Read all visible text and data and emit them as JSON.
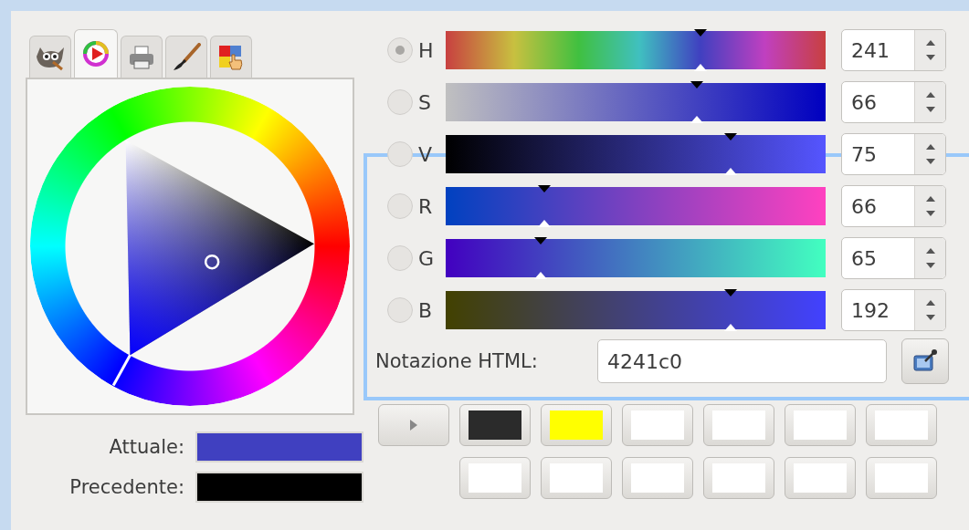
{
  "tabs": [
    {
      "kind": "mascot",
      "selected": false
    },
    {
      "kind": "wheel",
      "selected": true
    },
    {
      "kind": "printer",
      "selected": false
    },
    {
      "kind": "brush",
      "selected": false
    },
    {
      "kind": "palette",
      "selected": false
    }
  ],
  "current": {
    "label": "Attuale:",
    "color": "#4040c0"
  },
  "previous": {
    "label": "Precedente:",
    "color": "#000000"
  },
  "sliders": [
    {
      "label": "H",
      "selected": true,
      "level": 0.67,
      "value": "241"
    },
    {
      "label": "S",
      "selected": false,
      "level": 0.66,
      "value": "66"
    },
    {
      "label": "V",
      "selected": false,
      "level": 0.75,
      "value": "75"
    },
    {
      "label": "R",
      "selected": false,
      "level": 0.26,
      "value": "66"
    },
    {
      "label": "G",
      "selected": false,
      "level": 0.25,
      "value": "65"
    },
    {
      "label": "B",
      "selected": false,
      "level": 0.75,
      "value": "192"
    }
  ],
  "html_notation": {
    "label": "Notazione HTML:",
    "value": "4241c0"
  },
  "swatches": [
    {
      "color": "#2b2b2b"
    },
    {
      "color": "#ffff00"
    },
    {
      "color": "#ffffff"
    },
    {
      "color": "#ffffff"
    },
    {
      "color": "#ffffff"
    },
    {
      "color": "#ffffff"
    },
    {
      "color": "#ffffff"
    },
    {
      "color": "#ffffff"
    },
    {
      "color": "#ffffff"
    },
    {
      "color": "#ffffff"
    },
    {
      "color": "#ffffff"
    },
    {
      "color": "#ffffff"
    }
  ]
}
